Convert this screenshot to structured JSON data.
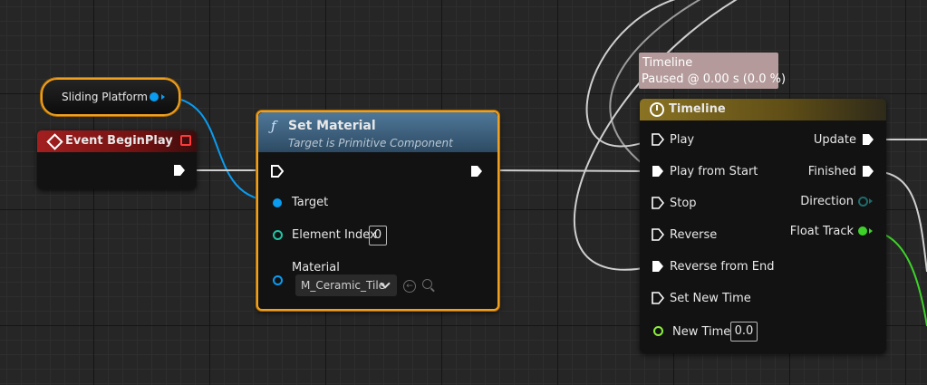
{
  "variable_node": {
    "label": "Sliding Platform"
  },
  "event_node": {
    "title": "Event BeginPlay"
  },
  "set_material": {
    "title": "Set Material",
    "subtitle": "Target is Primitive Component",
    "function_icon": "function-icon",
    "pins": {
      "target": "Target",
      "element_index": "Element Index",
      "element_index_value": "0",
      "material": "Material"
    },
    "material_value": "M_Ceramic_Tile"
  },
  "timeline_tooltip": {
    "title": "Timeline",
    "status": "Paused @ 0.00 s (0.0 %)"
  },
  "timeline_node": {
    "title": "Timeline",
    "clock_icon": "clock-icon",
    "inputs": [
      "Play",
      "Play from Start",
      "Stop",
      "Reverse",
      "Reverse from End",
      "Set New Time"
    ],
    "new_time_label": "New Time",
    "new_time_value": "0.0",
    "outputs": {
      "update": "Update",
      "finished": "Finished",
      "direction": "Direction",
      "float_track": "Float Track"
    }
  },
  "colors": {
    "selection_outline": "#f0a020",
    "event_header": "#8c1a1a",
    "function_header": "#3b5b74",
    "timeline_header": "#6e5a1c",
    "object_pin": "#0a9cf0",
    "int_pin": "#1ec7a5",
    "float_pin": "#8cf03a",
    "float_track_pin": "#3ed12a",
    "direction_pin": "#1f6b6b",
    "exec_wire": "#cfcfcf"
  }
}
